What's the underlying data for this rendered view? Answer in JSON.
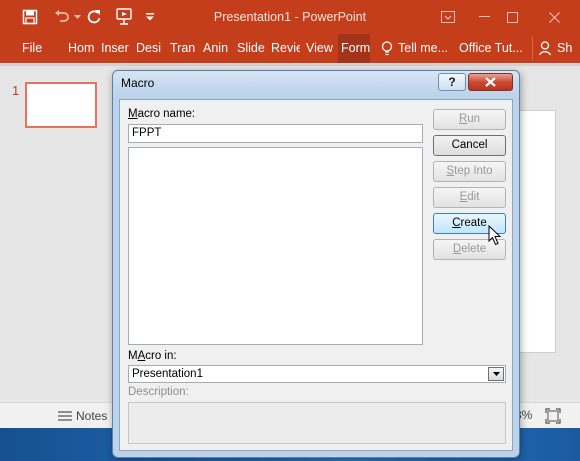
{
  "window": {
    "title": "Presentation1 - PowerPoint",
    "accent_color": "#c43e1c"
  },
  "quick_access": {
    "icons": [
      "save-icon",
      "undo-icon",
      "redo-icon",
      "present-from-beginning-icon",
      "customize-qat-icon"
    ]
  },
  "ribbon": {
    "tabs": [
      {
        "label": "File"
      },
      {
        "label": "Hom"
      },
      {
        "label": "Inser"
      },
      {
        "label": "Desi"
      },
      {
        "label": "Tran"
      },
      {
        "label": "Anin"
      },
      {
        "label": "Slide"
      },
      {
        "label": "Revie"
      },
      {
        "label": "View"
      },
      {
        "label": "Form"
      }
    ],
    "tell_me": "Tell me...",
    "office_tut": "Office Tut...",
    "share": "Sh"
  },
  "thumbnails": {
    "slide_number": "1"
  },
  "status": {
    "notes_label": "Notes",
    "zoom": "3%"
  },
  "dialog": {
    "title": "Macro",
    "help_label": "?",
    "macro_name_label_key": "M",
    "macro_name_label_rest": "acro name:",
    "macro_name_value": "FPPT",
    "macros": [],
    "macro_in_label_key": "A",
    "macro_in_label_before": "M",
    "macro_in_label_rest": "cro in:",
    "macro_in_value": "Presentation1",
    "description_label": "Description:",
    "buttons": {
      "run": {
        "key": "R",
        "rest": "un"
      },
      "cancel": {
        "label": "Cancel"
      },
      "step_into": {
        "key": "S",
        "rest": "tep Into"
      },
      "edit": {
        "key": "E",
        "rest": "dit"
      },
      "create": {
        "key": "C",
        "rest": "reate"
      },
      "delete": {
        "key": "D",
        "rest": "elete"
      }
    }
  }
}
